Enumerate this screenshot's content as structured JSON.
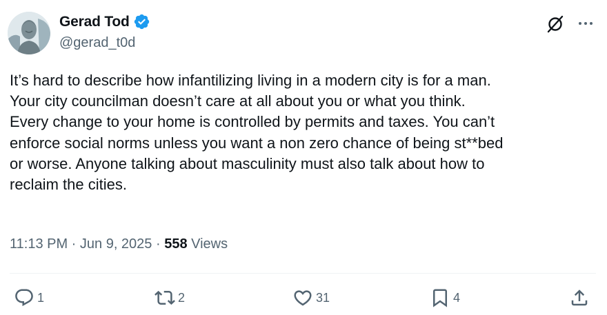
{
  "author": {
    "display_name": "Gerad Tod",
    "handle": "@gerad_t0d",
    "verified": true
  },
  "tweet": {
    "text": "It’s hard to describe how infantilizing living in a modern city is for a man.\nYour city councilman doesn’t care at all about you or what you think.\nEvery change to your home is controlled by permits and taxes. You can’t\nenforce social norms unless you want a non zero chance of being st**bed\nor worse. Anyone talking about masculinity must also talk about how to\nreclaim the cities."
  },
  "meta": {
    "timestamp": "11:13 PM · Jun 9, 2025 · ",
    "views_count": "558",
    "views_label": " Views"
  },
  "actions": {
    "reply_count": "1",
    "retweet_count": "2",
    "like_count": "31",
    "bookmark_count": "4"
  },
  "colors": {
    "text": "#0f1419",
    "secondary": "#536471",
    "verified": "#1d9bf0",
    "divider": "#eff3f4"
  },
  "icons": [
    "verified-badge-icon",
    "grok-icon",
    "more-icon",
    "reply-icon",
    "retweet-icon",
    "like-icon",
    "bookmark-icon",
    "share-icon"
  ]
}
